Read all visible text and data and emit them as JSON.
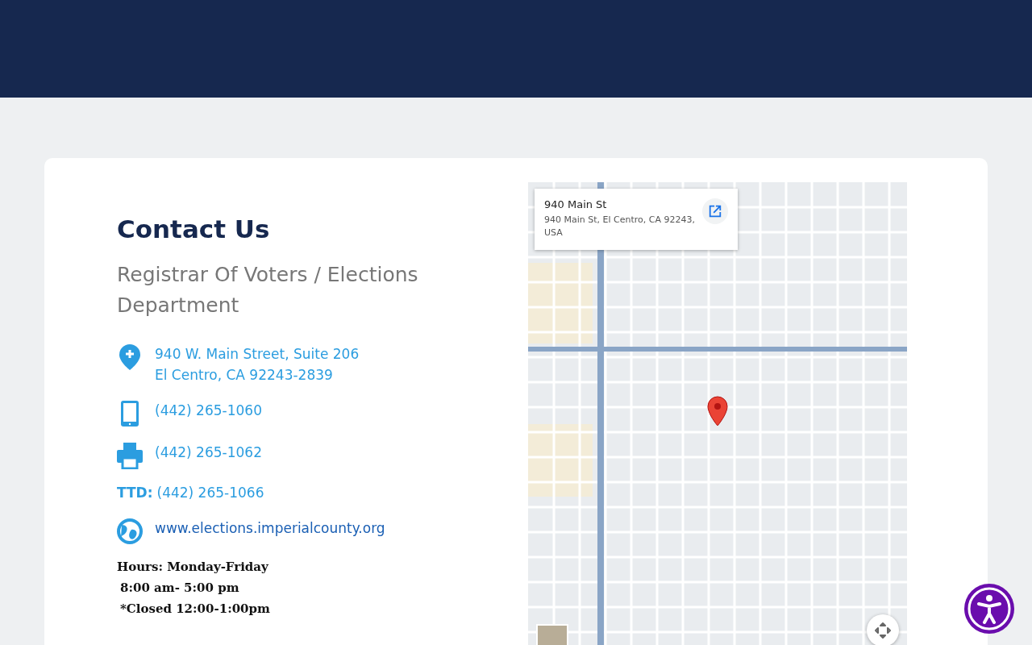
{
  "contact": {
    "title": "Contact Us",
    "department": "Registrar Of Voters / Elections Department",
    "address": [
      "940 W. Main Street, Suite 206",
      "El Centro, CA 92243-2839"
    ],
    "phone": "(442) 265-1060",
    "fax": "(442) 265-1062",
    "ttd": {
      "label": "TTD:",
      "number": "(442) 265-1066"
    },
    "website": "www.elections.imperialcounty.org",
    "hours": [
      "Hours: Monday-Friday",
      "8:00 am- 5:00 pm",
      "*Closed 12:00-1:00pm"
    ]
  },
  "map": {
    "place_card": {
      "title": "940 Main St",
      "address": "940 Main St, El Centro, CA 92243, USA"
    }
  }
}
